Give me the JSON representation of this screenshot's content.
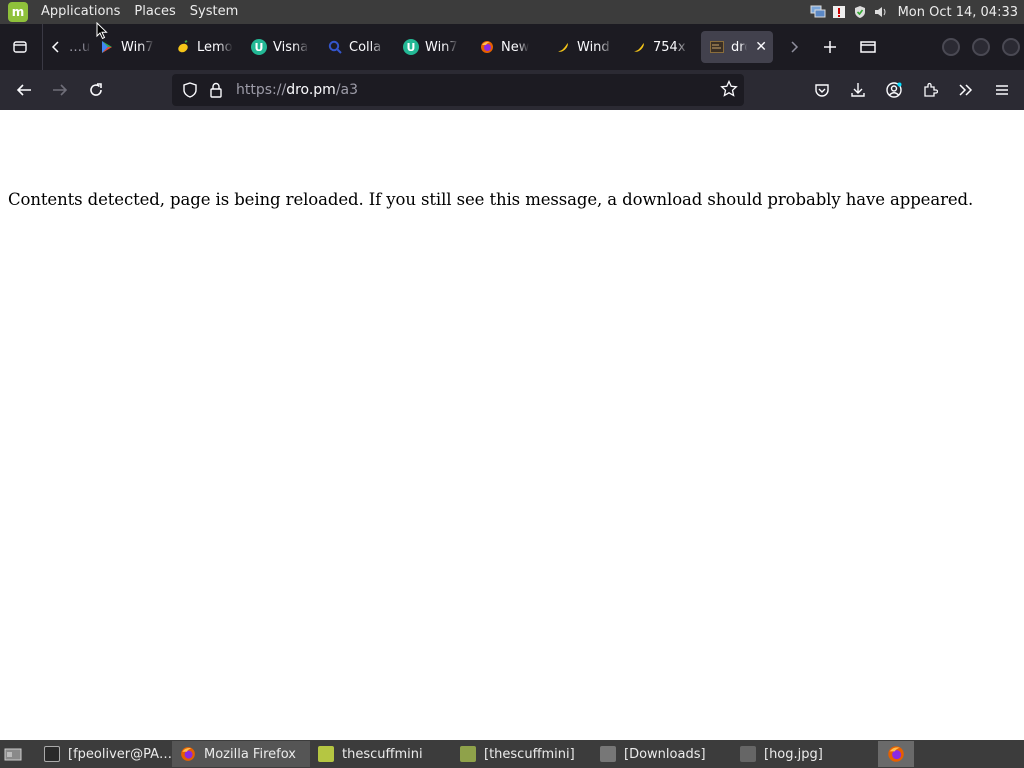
{
  "top_panel": {
    "menu": [
      "Applications",
      "Places",
      "System"
    ],
    "clock": "Mon Oct 14, 04:33"
  },
  "tabs": [
    {
      "label": "…u",
      "icon": "partial-tab-icon",
      "color": "#1c1b22"
    },
    {
      "label": "Win7",
      "icon": "google-play-icon",
      "color": "#34a853"
    },
    {
      "label": "Lemo",
      "icon": "lemon-icon",
      "color": "#f5c518"
    },
    {
      "label": "Visna",
      "icon": "u-icon",
      "color": "#23b895"
    },
    {
      "label": "Colla",
      "icon": "search-q-icon",
      "color": "#3355cc"
    },
    {
      "label": "Win7",
      "icon": "u-icon",
      "color": "#23b895"
    },
    {
      "label": "New",
      "icon": "firefox-icon",
      "color": "#e66000"
    },
    {
      "label": "Wind",
      "icon": "banana-icon",
      "color": "#f5c518"
    },
    {
      "label": "754x",
      "icon": "banana-icon",
      "color": "#f5c518"
    },
    {
      "label": "dro",
      "icon": "page-icon",
      "color": "#8a6d3b",
      "active": true
    }
  ],
  "url": {
    "protocol": "https://",
    "host": "dro.pm",
    "path": "/a3"
  },
  "page": {
    "message": "Contents detected, page is being reloaded. If you still see this message, a download should probably have appeared."
  },
  "taskbar": {
    "tasks": [
      {
        "label": "[fpeoliver@PA…",
        "icon": "terminal-icon",
        "color": "#555"
      },
      {
        "label": "Mozilla Firefox",
        "icon": "firefox-icon",
        "color": "#e66000",
        "active": true
      },
      {
        "label": "thescuffmini",
        "icon": "image-viewer-icon",
        "color": "#b5c642"
      },
      {
        "label": "[thescuffmini]",
        "icon": "image-viewer-icon",
        "color": "#b5c642"
      },
      {
        "label": "[Downloads]",
        "icon": "folder-icon",
        "color": "#777"
      },
      {
        "label": "[hog.jpg]",
        "icon": "image-file-icon",
        "color": "#666"
      }
    ]
  },
  "colors": {
    "panel": "#3c3c3c",
    "tabstrip": "#1c1b22",
    "toolbar": "#2b2a33",
    "urlbar": "#1c1b22"
  }
}
